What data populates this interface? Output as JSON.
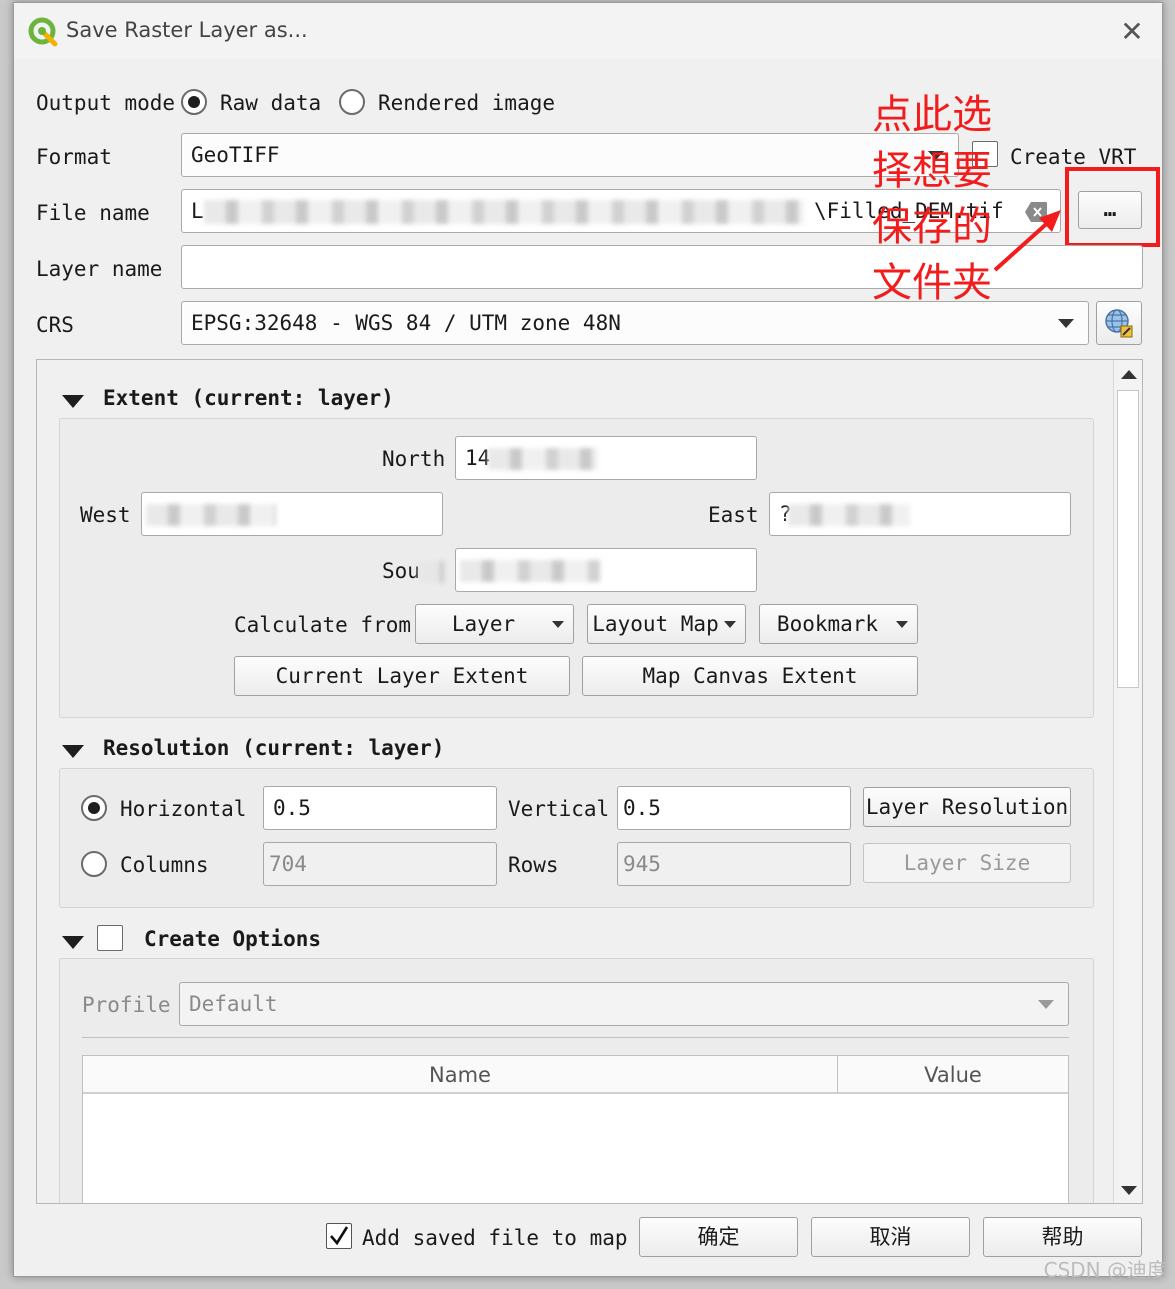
{
  "window": {
    "title": "Save Raster Layer as..."
  },
  "form": {
    "output_mode_label": "Output mode",
    "raw_data_label": "Raw data",
    "rendered_image_label": "Rendered image",
    "format_label": "Format",
    "format_value": "GeoTIFF",
    "create_vrt_label": "Create VRT",
    "file_name_label": "File name",
    "file_name_visible_start": "L",
    "file_name_visible_end": "\\Filled_DEM.tif",
    "browse_label": "…",
    "layer_name_label": "Layer name",
    "layer_name_value": "",
    "crs_label": "CRS",
    "crs_value": "EPSG:32648 - WGS 84 / UTM zone 48N"
  },
  "extent": {
    "title": "Extent (current: layer)",
    "north_label": "North",
    "north_value": "14",
    "west_label": "West",
    "east_label": "East",
    "east_value": "?",
    "south_label": "Sou",
    "calculate_from_label": "Calculate from",
    "layer_btn": "Layer",
    "layout_map_btn": "Layout Map",
    "bookmark_btn": "Bookmark",
    "current_layer_extent_btn": "Current Layer Extent",
    "map_canvas_extent_btn": "Map Canvas Extent"
  },
  "resolution": {
    "title": "Resolution (current: layer)",
    "horizontal_label": "Horizontal",
    "horizontal_value": "0.5",
    "vertical_label": "Vertical",
    "vertical_value": "0.5",
    "layer_resolution_btn": "Layer Resolution",
    "columns_label": "Columns",
    "columns_value": "704",
    "rows_label": "Rows",
    "rows_value": "945",
    "layer_size_btn": "Layer Size"
  },
  "create_options": {
    "title": "Create Options",
    "profile_label": "Profile",
    "profile_value": "Default",
    "table_headers": [
      "Name",
      "Value"
    ]
  },
  "footer": {
    "add_to_map_label": "Add saved file to map",
    "ok_btn": "确定",
    "cancel_btn": "取消",
    "help_btn": "帮助"
  },
  "annotation": {
    "lines": [
      "点此选",
      "择想要",
      "保存的",
      "文件夹"
    ],
    "color": "#f21c1c"
  },
  "watermark": "CSDN @迪度"
}
